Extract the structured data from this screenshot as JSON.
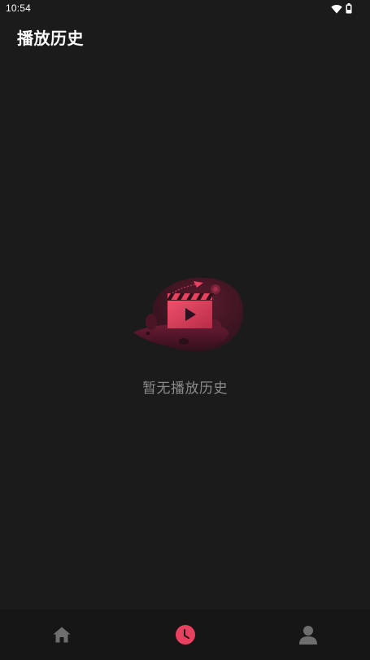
{
  "status_bar": {
    "time": "10:54",
    "icons": [
      "wifi-icon",
      "battery-icon"
    ]
  },
  "header": {
    "title": "播放历史"
  },
  "empty_state": {
    "illustration": "video-clapperboard-illustration",
    "message": "暂无播放历史"
  },
  "bottom_nav": {
    "items": [
      {
        "icon": "home-icon",
        "active": false
      },
      {
        "icon": "clock-icon",
        "active": true
      },
      {
        "icon": "user-icon",
        "active": false
      }
    ]
  },
  "colors": {
    "background": "#1b1b1b",
    "nav_background": "#161616",
    "accent": "#e8405f",
    "inactive_icon": "#6e6e6e",
    "empty_text": "#8a8a8a"
  }
}
